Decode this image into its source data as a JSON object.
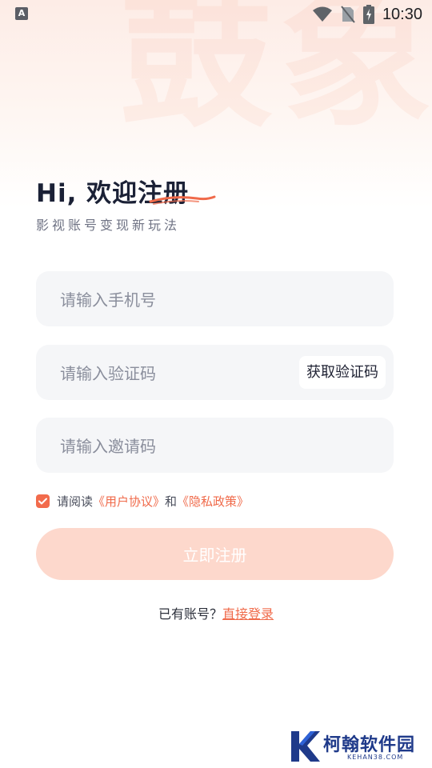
{
  "status_bar": {
    "time": "10:30",
    "left_icon": "a-notification-icon",
    "icons": [
      "wifi-icon",
      "no-sim-icon",
      "battery-charging-icon"
    ]
  },
  "background_text": "鼓象",
  "heading": {
    "title": "Hi, 欢迎注册",
    "subtitle": "影视账号变现新玩法"
  },
  "form": {
    "phone_placeholder": "请输入手机号",
    "code_placeholder": "请输入验证码",
    "get_code_label": "获取验证码",
    "invite_placeholder": "请输入邀请码"
  },
  "agreement": {
    "checked": true,
    "prefix": "请阅读",
    "user_agreement": "《用户协议》",
    "and": "和",
    "privacy_policy": "《隐私政策》"
  },
  "submit_label": "立即注册",
  "login_prompt": {
    "text": "已有账号？",
    "link": "直接登录"
  },
  "watermark": {
    "name": "柯翰软件园",
    "domain": "KEHAN38.COM"
  },
  "colors": {
    "accent": "#f06a4a",
    "submit_disabled": "#fdd8cc",
    "field_bg": "#f5f6f8",
    "title": "#1b2136"
  }
}
